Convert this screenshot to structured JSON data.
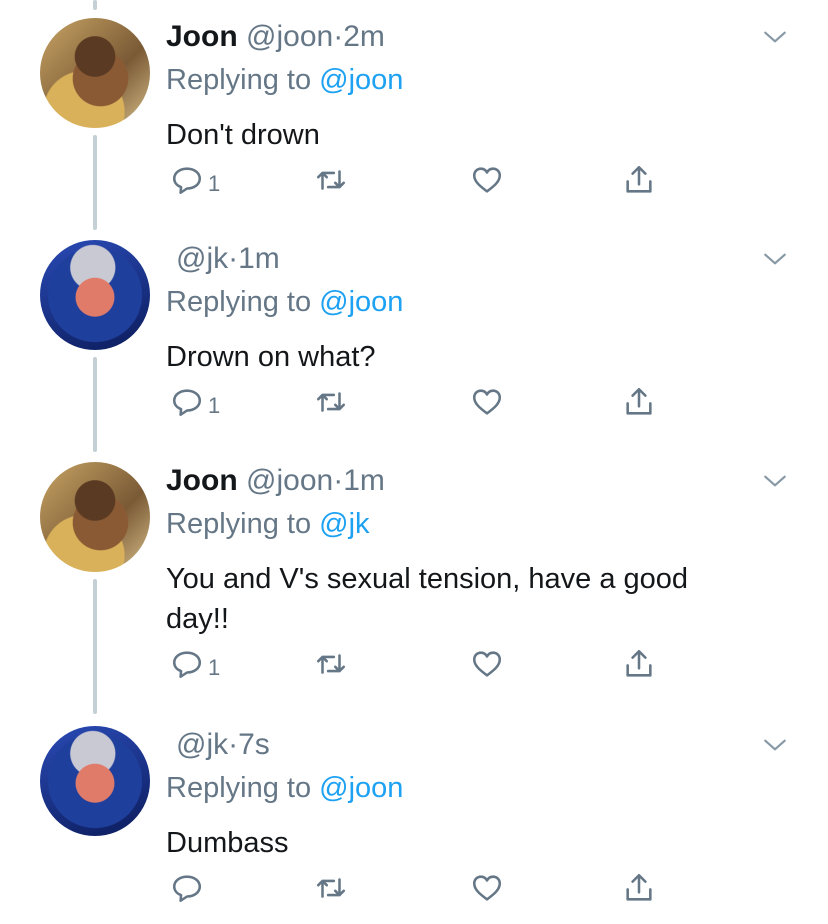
{
  "tweets": [
    {
      "name": "Joon",
      "handle": "@joon",
      "sep": "·",
      "time": "2m",
      "replying_prefix": "Replying to ",
      "replying_to": "@joon",
      "text": "Don't drown",
      "reply_count": "1",
      "avatar": "joon"
    },
    {
      "name": "",
      "handle": "@jk",
      "sep": "·",
      "time": "1m",
      "replying_prefix": "Replying to ",
      "replying_to": "@joon",
      "text": "Drown on what?",
      "reply_count": "1",
      "avatar": "jk"
    },
    {
      "name": "Joon",
      "handle": "@joon",
      "sep": "·",
      "time": "1m",
      "replying_prefix": "Replying to ",
      "replying_to": "@jk",
      "text": "You and V's sexual tension, have a good day!!",
      "reply_count": "1",
      "avatar": "joon"
    },
    {
      "name": "",
      "handle": "@jk",
      "sep": "·",
      "time": "7s",
      "replying_prefix": "Replying to ",
      "replying_to": "@joon",
      "text": "Dumbass",
      "reply_count": "",
      "avatar": "jk"
    }
  ],
  "icons": {
    "reply": "reply-icon",
    "retweet": "retweet-icon",
    "like": "heart-icon",
    "share": "share-icon",
    "menu": "chevron-down-icon"
  },
  "colors": {
    "link": "#1da1f2",
    "muted": "#657786",
    "thread_line": "#c4cfd6"
  }
}
